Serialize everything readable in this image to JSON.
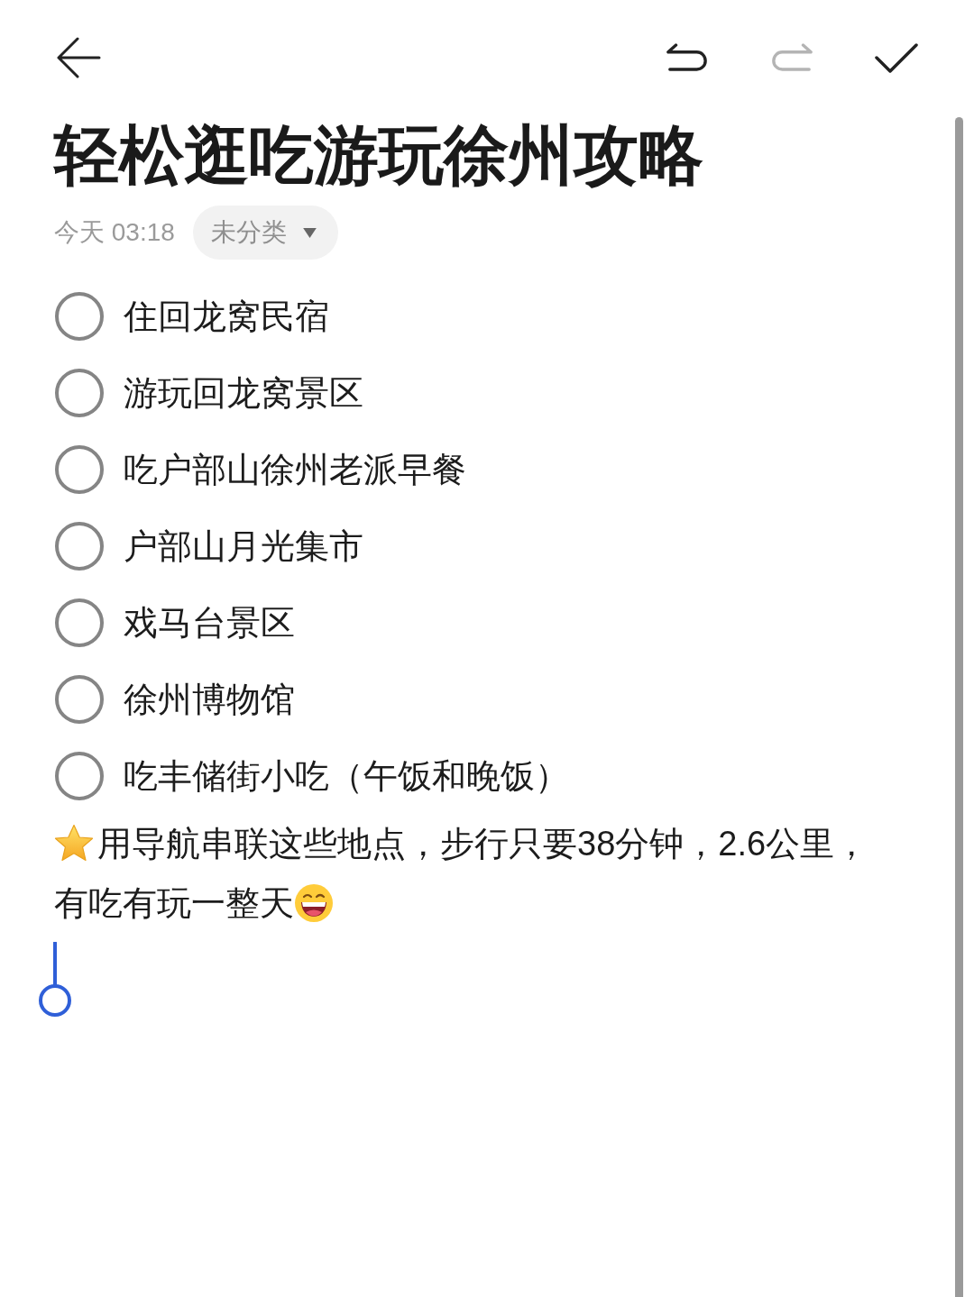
{
  "toolbar": {
    "history_buttons": [
      {
        "kind": "undo",
        "disabled": false
      },
      {
        "kind": "redo",
        "disabled": true
      }
    ]
  },
  "title": "轻松逛吃游玩徐州攻略",
  "meta": {
    "timestamp": "今天 03:18",
    "category": "未分类"
  },
  "checklist": [
    {
      "text": "住回龙窝民宿",
      "checked": false
    },
    {
      "text": "游玩回龙窝景区",
      "checked": false
    },
    {
      "text": "吃户部山徐州老派早餐",
      "checked": false
    },
    {
      "text": "户部山月光集市",
      "checked": false
    },
    {
      "text": "戏马台景区",
      "checked": false
    },
    {
      "text": "徐州博物馆",
      "checked": false
    },
    {
      "text": "吃丰储街小吃（午饭和晚饭）",
      "checked": false
    }
  ],
  "note_lines": [
    "用导航串联这些地点，步行只要38分钟，2.6公里，",
    "有吃有玩一整天"
  ]
}
